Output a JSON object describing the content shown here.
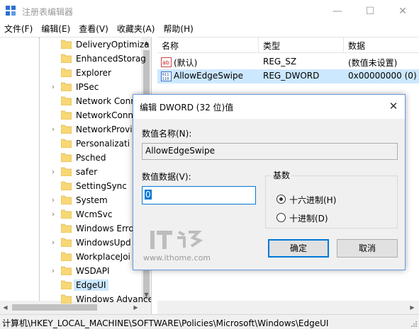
{
  "window": {
    "title": "注册表编辑器",
    "minimize": "—",
    "maximize": "☐",
    "close": "✕"
  },
  "menu": [
    "文件(F)",
    "编辑(E)",
    "查看(V)",
    "收藏夹(A)",
    "帮助(H)"
  ],
  "tree": {
    "items": [
      {
        "label": "DeliveryOptimiza",
        "expandable": false
      },
      {
        "label": "EnhancedStorag",
        "expandable": false
      },
      {
        "label": "Explorer",
        "expandable": false
      },
      {
        "label": "IPSec",
        "expandable": true
      },
      {
        "label": "Network Conn",
        "expandable": false
      },
      {
        "label": "NetworkConn",
        "expandable": false
      },
      {
        "label": "NetworkProvi",
        "expandable": true
      },
      {
        "label": "Personalizati",
        "expandable": false
      },
      {
        "label": "Psched",
        "expandable": false
      },
      {
        "label": "safer",
        "expandable": true
      },
      {
        "label": "SettingSync",
        "expandable": false
      },
      {
        "label": "System",
        "expandable": true
      },
      {
        "label": "WcmSvc",
        "expandable": true
      },
      {
        "label": "Windows Erro",
        "expandable": false
      },
      {
        "label": "WindowsUpd",
        "expandable": true
      },
      {
        "label": "WorkplaceJoi",
        "expandable": false
      },
      {
        "label": "WSDAPI",
        "expandable": true
      },
      {
        "label": "EdgeUI",
        "expandable": false,
        "selected": true
      },
      {
        "label": "Windows Advanced",
        "expandable": false
      }
    ]
  },
  "list": {
    "headers": [
      "名称",
      "类型",
      "数据"
    ],
    "rows": [
      {
        "icon": "string-value-icon",
        "name": "(默认)",
        "type": "REG_SZ",
        "data": "(数值未设置)",
        "selected": false
      },
      {
        "icon": "binary-value-icon",
        "name": "AllowEdgeSwipe",
        "type": "REG_DWORD",
        "data": "0x00000000 (0)",
        "selected": true
      }
    ]
  },
  "status": {
    "path": "计算机\\HKEY_LOCAL_MACHINE\\SOFTWARE\\Policies\\Microsoft\\Windows\\EdgeUI"
  },
  "dialog": {
    "title": "编辑 DWORD (32 位)值",
    "close": "✕",
    "name_label": "数值名称(N):",
    "name_value": "AllowEdgeSwipe",
    "data_label": "数值数据(V):",
    "data_value": "0",
    "base_label": "基数",
    "base_options": [
      {
        "label": "十六进制(H)",
        "checked": true
      },
      {
        "label": "十进制(D)",
        "checked": false
      }
    ],
    "ok": "确定",
    "cancel": "取消",
    "watermark_logo": "IT之家",
    "watermark_url": "www.ithome.com"
  },
  "colors": {
    "accent": "#0078d7",
    "selection": "#cce8ff",
    "folder": "#f8d775",
    "dialog_bg": "#f0f0f0"
  }
}
